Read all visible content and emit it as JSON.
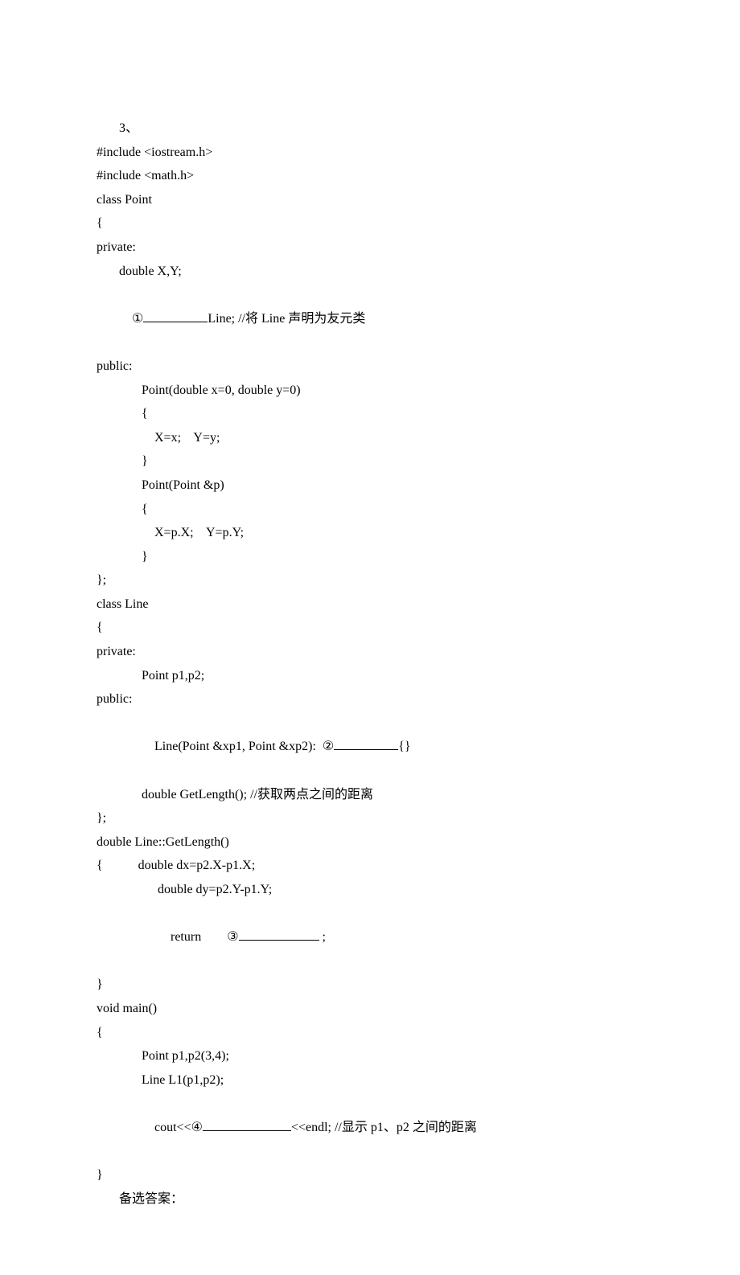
{
  "header": "3、",
  "code": {
    "l01": "#include <iostream.h>",
    "l02": "#include <math.h>",
    "l03": "class Point",
    "l04": "{",
    "l05": "private:",
    "l06": "double X,Y;",
    "l07a": "①",
    "l07b": "Line; //将 Line 声明为友元类",
    "l08": "public:",
    "l09": "Point(double x=0, double y=0)",
    "l10": "{",
    "l11": "X=x;    Y=y;",
    "l12": "}",
    "l13": "Point(Point &p)",
    "l14": "{",
    "l15": "X=p.X;    Y=p.Y;",
    "l16": "}",
    "l17": "};",
    "l18": "class Line",
    "l19": "{",
    "l20": "private:",
    "l21": "Point p1,p2;",
    "l22": "public:",
    "l23a": "Line(Point &xp1, Point &xp2):  ②",
    "l23b": "{}",
    "l24": "double GetLength(); //获取两点之间的距离",
    "l25": "};",
    "l26": "double Line::GetLength()",
    "l27": "{           double dx=p2.X-p1.X;",
    "l28": "double dy=p2.Y-p1.Y;",
    "l29a": "return        ③",
    "l29b": " ;",
    "l30": "}",
    "l31": "void main()",
    "l32": "{",
    "l33": "Point p1,p2(3,4);",
    "l34": "Line L1(p1,p2);",
    "l35a": "cout<<④",
    "l35b": "<<endl; //显示 p1、p2 之间的距离",
    "l36": "}"
  },
  "footer": "备选答案："
}
